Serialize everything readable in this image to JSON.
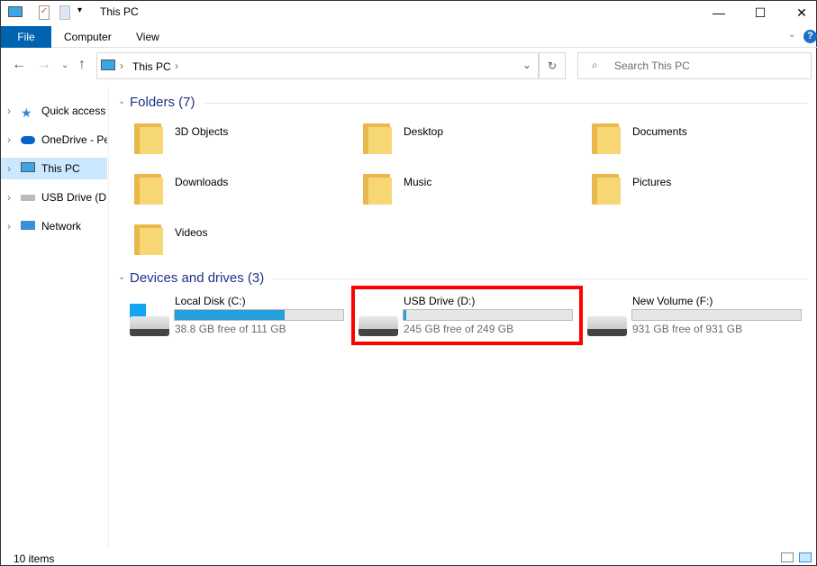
{
  "window": {
    "title": "This PC",
    "minimize": "—",
    "maximize": "☐",
    "close": "✕"
  },
  "ribbon": {
    "tabs": [
      "File",
      "Computer",
      "View"
    ]
  },
  "address": {
    "path": "This PC",
    "search_placeholder": "Search This PC"
  },
  "nav": {
    "items": [
      {
        "label": "Quick access"
      },
      {
        "label": "OneDrive - Pe"
      },
      {
        "label": "This PC",
        "selected": true
      },
      {
        "label": "USB Drive (D:)"
      },
      {
        "label": "Network"
      }
    ]
  },
  "folders": {
    "header": "Folders (7)",
    "items": [
      "3D Objects",
      "Desktop",
      "Documents",
      "Downloads",
      "Music",
      "Pictures",
      "Videos"
    ]
  },
  "drives": {
    "header": "Devices and drives (3)",
    "items": [
      {
        "name": "Local Disk (C:)",
        "free": "38.8 GB free of 111 GB",
        "used_fraction": 0.65
      },
      {
        "name": "USB Drive (D:)",
        "free": "245 GB free of 249 GB",
        "used_fraction": 0.016,
        "highlighted": true
      },
      {
        "name": "New Volume (F:)",
        "free": "931 GB free of 931 GB",
        "used_fraction": 0.0
      }
    ]
  },
  "colors": {
    "accent": "#0063b1",
    "bar": "#26a0da",
    "highlight": "#ff0000",
    "group": "#1e3287"
  },
  "status": {
    "items": "10 items"
  }
}
